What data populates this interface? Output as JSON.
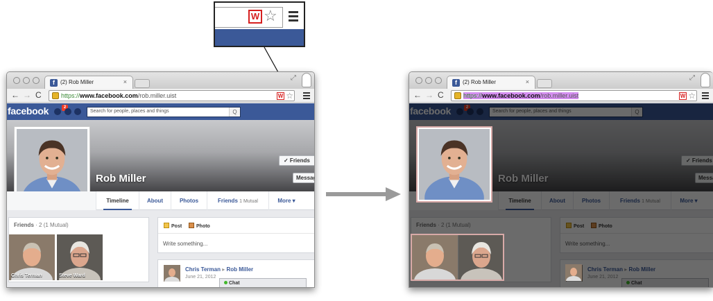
{
  "tab": {
    "title": "(2) Rob Miller",
    "favicon": "f",
    "close": "×"
  },
  "url": {
    "protocol": "https://",
    "host": "www.facebook.com",
    "path": "/rob.miller.uist"
  },
  "extension_label": "W",
  "facebook": {
    "logo": "facebook",
    "notification_count": "2",
    "search_placeholder": "Search for people, places and things",
    "search_icon": "Q"
  },
  "profile": {
    "name": "Rob Miller",
    "friends_button": "✓ Friends",
    "message_button": "Message"
  },
  "tabs": [
    {
      "label": "Timeline",
      "sub": ""
    },
    {
      "label": "About",
      "sub": ""
    },
    {
      "label": "Photos",
      "sub": ""
    },
    {
      "label": "Friends",
      "sub": "1 Mutual"
    },
    {
      "label": "More ▾",
      "sub": ""
    }
  ],
  "friends_box": {
    "title": "Friends",
    "count": "· 2 (1 Mutual)",
    "friends": [
      "Chris Terman",
      "Steve Ward"
    ]
  },
  "composer": {
    "post": "Post",
    "photo": "Photo",
    "placeholder": "Write something..."
  },
  "story": {
    "actor": "Chris Terman",
    "separator": "▸",
    "target": "Rob Miller",
    "date": "June 21, 2012"
  },
  "chat": {
    "label": "Chat"
  },
  "colors": {
    "facebook_blue": "#3b5998",
    "highlight": "#d8aaa8",
    "url_selection": "#d48ef0",
    "extension_red": "#d61f1f"
  },
  "icons": [
    "friend-requests-icon",
    "messages-icon",
    "globe-icon",
    "lock-icon",
    "star-icon",
    "chrome-menu-icon",
    "arrow-icon"
  ]
}
